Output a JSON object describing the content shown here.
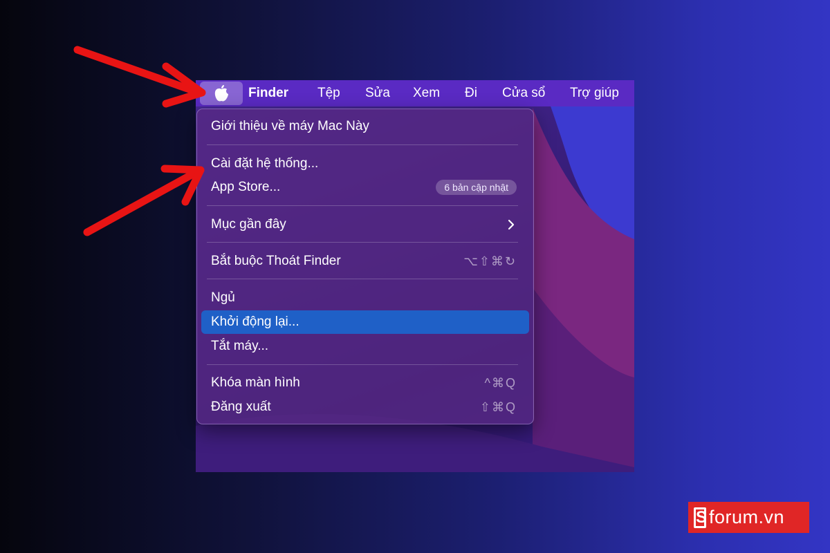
{
  "menubar": {
    "apple_icon": "apple-icon",
    "items": [
      "Finder",
      "Tệp",
      "Sửa",
      "Xem",
      "Đi",
      "Cửa sổ",
      "Trợ giúp"
    ]
  },
  "apple_menu": {
    "about": "Giới thiệu về máy Mac Này",
    "settings": "Cài đặt hệ thống...",
    "app_store": "App Store...",
    "app_store_badge": "6 bản cập nhật",
    "recent": "Mục gần đây",
    "recent_icon": "chevron-right-icon",
    "force_quit": "Bắt buộc Thoát Finder",
    "force_quit_shortcut": "⌥⇧⌘↻",
    "sleep": "Ngủ",
    "restart": "Khởi động lại...",
    "shutdown": "Tắt máy...",
    "lock": "Khóa màn hình",
    "lock_shortcut": "^⌘Q",
    "logout": "Đăng xuất",
    "logout_shortcut": "⇧⌘Q"
  },
  "logo": {
    "mark": "S",
    "text": "forum.vn"
  },
  "colors": {
    "menubar": "#5a2ac3",
    "highlight": "#1f60c7",
    "arrow": "#e81414",
    "logo_bg": "#e02626"
  }
}
